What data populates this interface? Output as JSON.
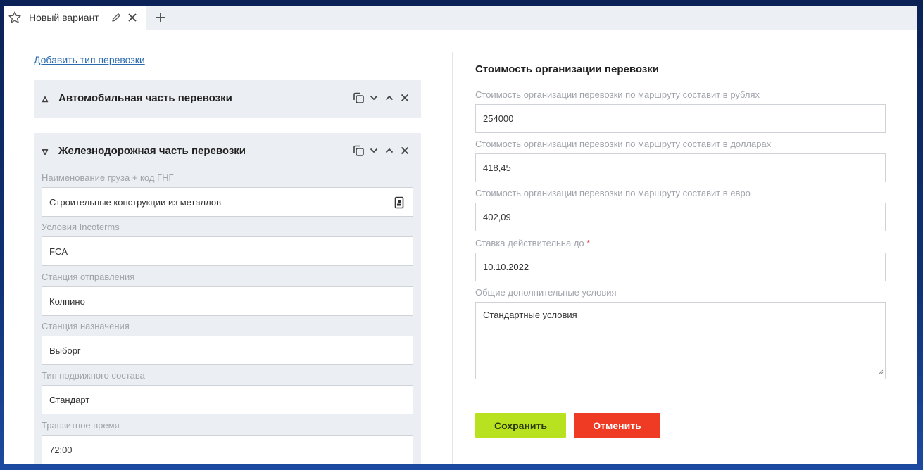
{
  "tab": {
    "title": "Новый вариант"
  },
  "left": {
    "add_link": "Добавить тип перевозки",
    "auto_panel": {
      "title": "Автомобильная часть перевозки"
    },
    "rail_panel": {
      "title": "Железнодорожная часть перевозки",
      "fields": [
        {
          "label": "Наименование груза + код ГНГ",
          "value": "Строительные конструкции из металлов"
        },
        {
          "label": "Условия Incoterms",
          "value": "FCA"
        },
        {
          "label": "Станция отправления",
          "value": "Колпино"
        },
        {
          "label": "Станция назначения",
          "value": "Выборг"
        },
        {
          "label": "Тип подвижного состава",
          "value": "Стандарт"
        },
        {
          "label": "Транзитное время",
          "value": "72:00"
        }
      ]
    }
  },
  "right": {
    "section_title": "Стоимость организации перевозки",
    "fields": [
      {
        "label": "Стоимость организации перевозки по маршруту составит в рублях",
        "value": "254000"
      },
      {
        "label": "Стоимость организации перевозки по маршруту составит в долларах",
        "value": "418,45"
      },
      {
        "label": "Стоимость организации перевозки по маршруту составит в евро",
        "value": "402,09"
      },
      {
        "label": "Ставка действительна до",
        "value": "10.10.2022",
        "required_mark": "*"
      }
    ],
    "extra": {
      "label": "Общие дополнительные условия",
      "value": "Стандартные условия"
    },
    "save_label": "Сохранить",
    "cancel_label": "Отменить"
  },
  "colors": {
    "save": "#b8e21f",
    "cancel": "#ef3b24",
    "link": "#2b6cb0",
    "panel": "#ebeef2"
  }
}
